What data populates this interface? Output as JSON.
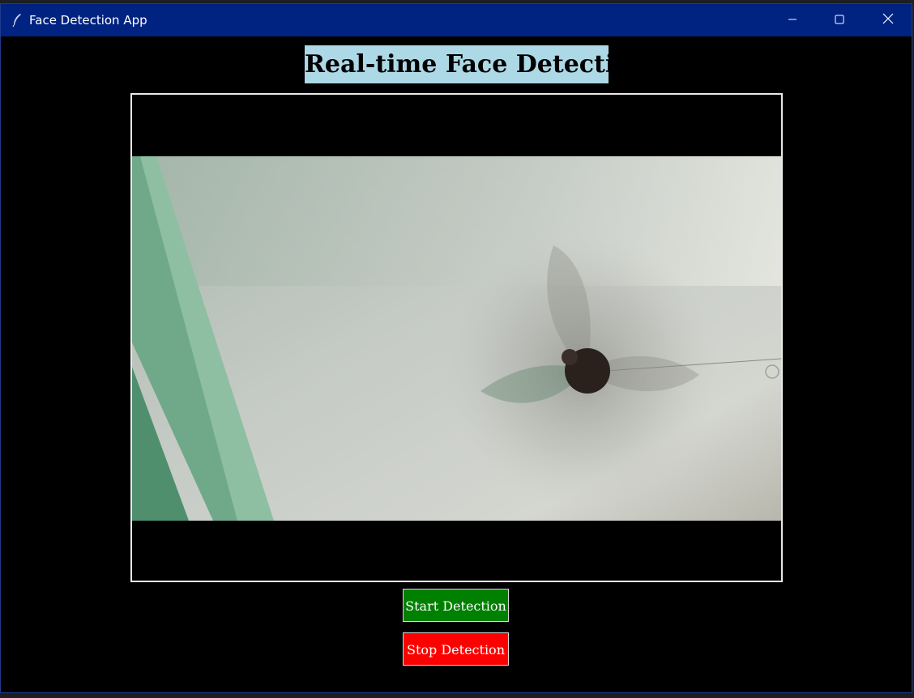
{
  "window": {
    "title": "Face Detection App",
    "icon": "feather-icon",
    "controls": [
      "minimize-icon",
      "maximize-icon",
      "close-icon"
    ]
  },
  "main": {
    "heading": "Real-time Face Detection",
    "video": {
      "content": "camera-feed"
    },
    "buttons": {
      "start_label": "Start Detection",
      "stop_label": "Stop Detection"
    }
  },
  "colors": {
    "titlebar": "#002280",
    "background": "#000000",
    "heading_bg": "#add8e6",
    "start_button": "#008000",
    "stop_button": "#ff0000"
  }
}
